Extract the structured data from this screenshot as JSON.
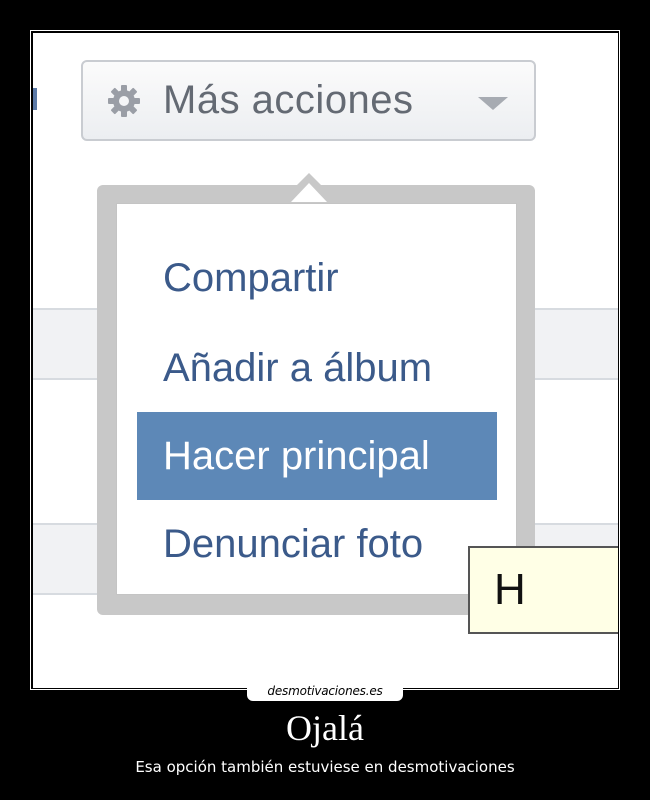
{
  "screenshot": {
    "button": {
      "label": "Más acciones",
      "icon": "gear-icon",
      "dropdown_icon": "caret-down-icon"
    },
    "menu": {
      "items": [
        {
          "label": "Compartir",
          "selected": false
        },
        {
          "label": "Añadir a álbum",
          "selected": false
        },
        {
          "label": "Hacer principal",
          "selected": true
        },
        {
          "label": "Denunciar foto",
          "selected": false
        }
      ]
    },
    "tooltip": {
      "text": "H"
    }
  },
  "footer": {
    "site": "desmotivaciones.es",
    "title": "Ojalá",
    "subtitle": "Esa opción también estuviese en desmotivaciones"
  },
  "colors": {
    "menu_text": "#3b5a8a",
    "selected_bg": "#5d88b7",
    "background": "#000000"
  }
}
